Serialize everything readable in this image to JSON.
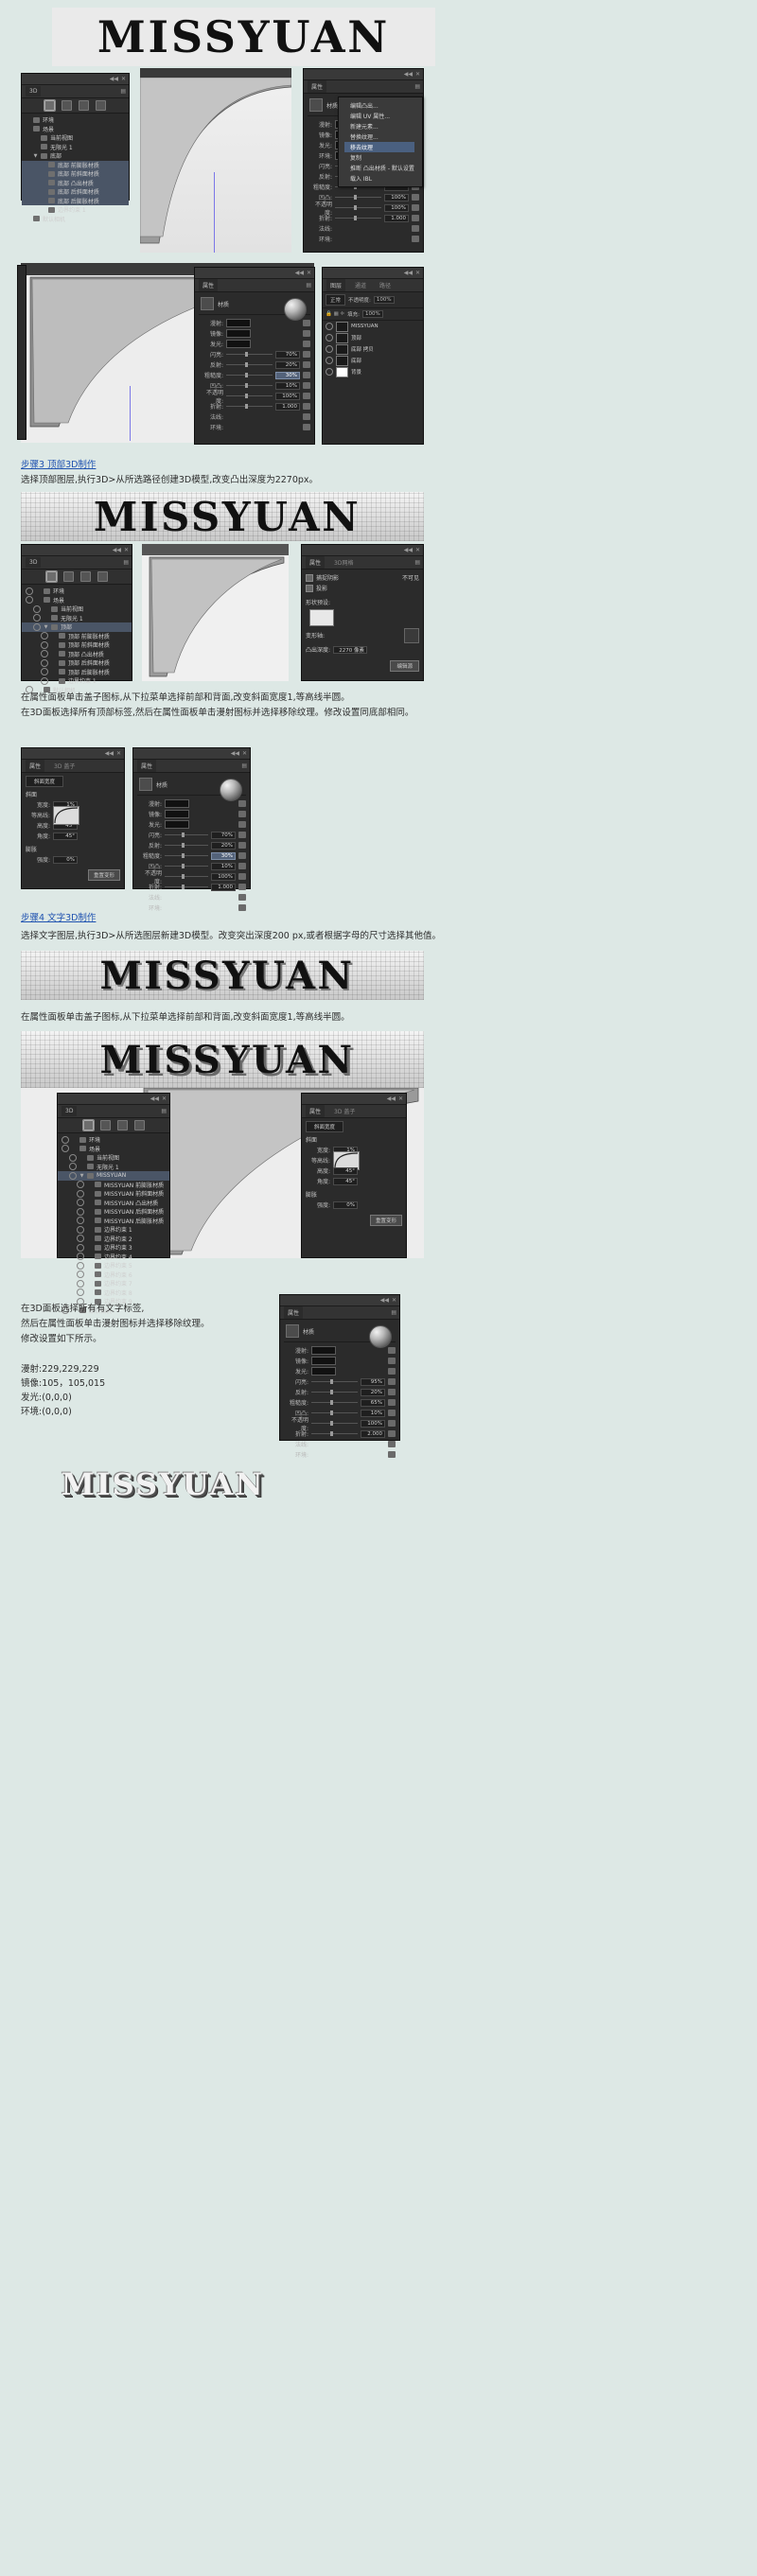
{
  "page": {
    "background_color": "#dde8e5",
    "wordmark": "MISSYUAN"
  },
  "captions": {
    "step3_title": "步骤3 顶部3D制作",
    "step3_text": "选择顶部图层,执行3D>从所选路径创建3D模型,改变凸出深度为2270px。",
    "mid_line1": "在属性面板单击盖子图标,从下拉菜单选择前部和背面,改变斜面宽度1,等高线半圆。",
    "mid_line2": "在3D面板选择所有顶部标签,然后在属性面板单击漫射图标并选择移除纹理。修改设置同底部相同。",
    "step4_title": "步骤4 文字3D制作",
    "step4_text": "选择文字图层,执行3D>从所选图层新建3D模型。改变突出深度200 px,或者根据字母的尺寸选择其他值。",
    "bevel_text": "在属性面板单击盖子图标,从下拉菜单选择前部和背面,改变斜面宽度1,等高线半圆。",
    "final_line1": "在3D面板选择所有有文字标签,",
    "final_line2": "然后在属性面板单击漫射图标并选择移除纹理。",
    "final_line3": "修改设置如下所示。",
    "values": [
      "漫射:229,229,229",
      "镜像:105，105,015",
      "发光:(0,0,0)",
      "环境:(0,0,0)"
    ]
  },
  "panel_3d": {
    "tab_label": "3D",
    "toolbar_icons": [
      "scene-icon",
      "mesh-icon",
      "material-icon",
      "light-icon"
    ],
    "tree_top": [
      {
        "label": "环境",
        "icon": "environment-icon",
        "indent": 0,
        "selected": false
      },
      {
        "label": "场景",
        "icon": "scene-icon",
        "indent": 0,
        "selected": false
      },
      {
        "label": "当前视图",
        "icon": "camera-icon",
        "indent": 1,
        "selected": false
      },
      {
        "label": "无限光 1",
        "icon": "light-icon",
        "indent": 1,
        "selected": false
      },
      {
        "label": "底部",
        "icon": "mesh-icon",
        "indent": 1,
        "selected": false,
        "twisty": "▼"
      },
      {
        "label": "底部 前膨胀材质",
        "icon": "material-icon",
        "indent": 2,
        "selected": true
      },
      {
        "label": "底部 前斜面材质",
        "icon": "material-icon",
        "indent": 2,
        "selected": true
      },
      {
        "label": "底部 凸出材质",
        "icon": "material-icon",
        "indent": 2,
        "selected": true
      },
      {
        "label": "底部 后斜面材质",
        "icon": "material-icon",
        "indent": 2,
        "selected": true
      },
      {
        "label": "底部 后膨胀材质",
        "icon": "material-icon",
        "indent": 2,
        "selected": true
      },
      {
        "label": "边界约束 1",
        "icon": "constraint-icon",
        "indent": 2,
        "selected": false
      },
      {
        "label": "默认相机",
        "icon": "camera-icon",
        "indent": 0,
        "selected": false
      }
    ],
    "tree_mid": [
      {
        "label": "环境",
        "icon": "environment-icon",
        "indent": 0,
        "selected": false
      },
      {
        "label": "场景",
        "icon": "scene-icon",
        "indent": 0,
        "selected": false
      },
      {
        "label": "当前视图",
        "icon": "camera-icon",
        "indent": 1,
        "selected": false
      },
      {
        "label": "无限光 1",
        "icon": "light-icon",
        "indent": 1,
        "selected": false
      },
      {
        "label": "顶部",
        "icon": "mesh-icon",
        "indent": 1,
        "selected": true,
        "twisty": "▼"
      },
      {
        "label": "顶部 前膨胀材质",
        "icon": "material-icon",
        "indent": 2,
        "selected": false
      },
      {
        "label": "顶部 前斜面材质",
        "icon": "material-icon",
        "indent": 2,
        "selected": false
      },
      {
        "label": "顶部 凸出材质",
        "icon": "material-icon",
        "indent": 2,
        "selected": false
      },
      {
        "label": "顶部 后斜面材质",
        "icon": "material-icon",
        "indent": 2,
        "selected": false
      },
      {
        "label": "顶部 后膨胀材质",
        "icon": "material-icon",
        "indent": 2,
        "selected": false
      },
      {
        "label": "边界约束 1",
        "icon": "constraint-icon",
        "indent": 2,
        "selected": false
      },
      {
        "label": "默认相机",
        "icon": "camera-icon",
        "indent": 0,
        "selected": false
      }
    ],
    "tree_text": [
      {
        "label": "环境",
        "icon": "environment-icon",
        "indent": 0,
        "selected": false
      },
      {
        "label": "场景",
        "icon": "scene-icon",
        "indent": 0,
        "selected": false
      },
      {
        "label": "当前视图",
        "icon": "camera-icon",
        "indent": 1,
        "selected": false
      },
      {
        "label": "无限光 1",
        "icon": "light-icon",
        "indent": 1,
        "selected": false
      },
      {
        "label": "MISSYUAN",
        "icon": "mesh-icon",
        "indent": 1,
        "selected": true,
        "twisty": "▼"
      },
      {
        "label": "MISSYUAN 前膨胀材质",
        "icon": "material-icon",
        "indent": 2,
        "selected": false
      },
      {
        "label": "MISSYUAN 前斜面材质",
        "icon": "material-icon",
        "indent": 2,
        "selected": false
      },
      {
        "label": "MISSYUAN 凸出材质",
        "icon": "material-icon",
        "indent": 2,
        "selected": false
      },
      {
        "label": "MISSYUAN 后斜面材质",
        "icon": "material-icon",
        "indent": 2,
        "selected": false
      },
      {
        "label": "MISSYUAN 后膨胀材质",
        "icon": "material-icon",
        "indent": 2,
        "selected": false
      },
      {
        "label": "边界约束 1",
        "icon": "constraint-icon",
        "indent": 2,
        "selected": false
      },
      {
        "label": "边界约束 2",
        "icon": "constraint-icon",
        "indent": 2,
        "selected": false
      },
      {
        "label": "边界约束 3",
        "icon": "constraint-icon",
        "indent": 2,
        "selected": false
      },
      {
        "label": "边界约束 4",
        "icon": "constraint-icon",
        "indent": 2,
        "selected": false
      },
      {
        "label": "边界约束 5",
        "icon": "constraint-icon",
        "indent": 2,
        "selected": false
      },
      {
        "label": "边界约束 6",
        "icon": "constraint-icon",
        "indent": 2,
        "selected": false
      },
      {
        "label": "边界约束 7",
        "icon": "constraint-icon",
        "indent": 2,
        "selected": false
      },
      {
        "label": "边界约束 8",
        "icon": "constraint-icon",
        "indent": 2,
        "selected": false
      },
      {
        "label": "边界约束 9",
        "icon": "constraint-icon",
        "indent": 2,
        "selected": false
      },
      {
        "label": "默认相机",
        "icon": "camera-icon",
        "indent": 0,
        "selected": false
      }
    ]
  },
  "properties_material_top": {
    "tab_label": "属性",
    "header": "材质",
    "rows": [
      {
        "label": "漫射:",
        "type": "swatch"
      },
      {
        "label": "镜像:",
        "type": "swatch"
      },
      {
        "label": "发光:",
        "type": "swatch"
      },
      {
        "label": "环境:",
        "type": "swatch"
      },
      {
        "label": "闪亮:",
        "value": ""
      },
      {
        "label": "反射:",
        "value": ""
      },
      {
        "label": "粗糙度:",
        "value": ""
      },
      {
        "label": "凹凸:",
        "value": "100%"
      },
      {
        "label": "不透明度:",
        "value": "100%"
      },
      {
        "label": "折射:",
        "value": "1.000"
      },
      {
        "label": "法线:",
        "type": "folder"
      },
      {
        "label": "环境:",
        "type": "folder"
      }
    ]
  },
  "properties_material_detail": {
    "tab_label": "属性",
    "header": "材质",
    "rows": [
      {
        "label": "漫射:",
        "type": "swatch"
      },
      {
        "label": "镜像:",
        "type": "swatch"
      },
      {
        "label": "发光:",
        "type": "swatch"
      },
      {
        "label": "闪亮:",
        "value": "70%"
      },
      {
        "label": "反射:",
        "value": "20%"
      },
      {
        "label": "粗糙度:",
        "value": "30%",
        "highlight": true
      },
      {
        "label": "凹凸:",
        "value": "10%"
      },
      {
        "label": "不透明度:",
        "value": "100%"
      },
      {
        "label": "折射:",
        "value": "1.000"
      },
      {
        "label": "法线:",
        "type": "folder"
      },
      {
        "label": "环境:",
        "type": "folder"
      }
    ]
  },
  "properties_material_final": {
    "tab_label": "属性",
    "header": "材质",
    "rows": [
      {
        "label": "漫射:",
        "type": "swatch"
      },
      {
        "label": "镜像:",
        "type": "swatch"
      },
      {
        "label": "发光:",
        "type": "swatch"
      },
      {
        "label": "闪亮:",
        "value": "95%"
      },
      {
        "label": "反射:",
        "value": "20%"
      },
      {
        "label": "粗糙度:",
        "value": "65%"
      },
      {
        "label": "凹凸:",
        "value": "10%"
      },
      {
        "label": "不透明度:",
        "value": "100%"
      },
      {
        "label": "折射:",
        "value": "2.000"
      },
      {
        "label": "法线:",
        "type": "folder"
      },
      {
        "label": "环境:",
        "type": "folder"
      }
    ]
  },
  "properties_extrude": {
    "tab_label": "属性",
    "tab2_label": "3D网格",
    "checkbox1": "捕捉阴影",
    "checkbox2": "投影",
    "checkbox_right": "不可见",
    "section_label": "形状预设:",
    "row_label": "变形轴:",
    "depth_label": "凸出深度:",
    "depth_value": "2270 像素",
    "button_label": "编辑源"
  },
  "properties_cap": {
    "tab_label": "属性",
    "tab2_label": "3D 盖子",
    "preset_label": "斜面",
    "side_label": "斜面宽度",
    "width_label": "宽度:",
    "width_value": "1%",
    "contour_label": "等高线:",
    "height_label": "高度:",
    "angle_label": "45°",
    "angle_value": "45°",
    "inflate_label": "膨胀",
    "inflate_angle": "45°",
    "inflate_strength": "0%",
    "reset_button": "重置变形"
  },
  "layers_panel": {
    "tabs": [
      "图层",
      "通道",
      "路径"
    ],
    "blend_mode": "正常",
    "opacity_label": "不透明度:",
    "opacity_value": "100%",
    "fill_label": "填充:",
    "fill_value": "100%",
    "rows": [
      {
        "name": "MISSYUAN",
        "type": "text-layer",
        "selected": false
      },
      {
        "name": "顶部",
        "type": "shape-layer",
        "selected": false
      },
      {
        "name": "底部 拷贝",
        "type": "shape-layer",
        "selected": false
      },
      {
        "name": "底部",
        "type": "shape-layer",
        "selected": false
      },
      {
        "name": "背景",
        "type": "bg-layer",
        "selected": false
      }
    ]
  },
  "dropdown_menu": {
    "items": [
      {
        "label": "编辑凸出...",
        "highlighted": false
      },
      {
        "label": "编辑 UV 属性...",
        "highlighted": false
      },
      {
        "label": "新建元素...",
        "highlighted": false
      },
      {
        "label": "替换纹理...",
        "highlighted": false
      },
      {
        "label": "移去纹理",
        "highlighted": true
      },
      {
        "label": "复制",
        "highlighted": false
      },
      {
        "label": "推断 凸出材质 - 默认设置",
        "highlighted": false
      },
      {
        "label": "载入 IBL",
        "highlighted": false
      }
    ]
  }
}
